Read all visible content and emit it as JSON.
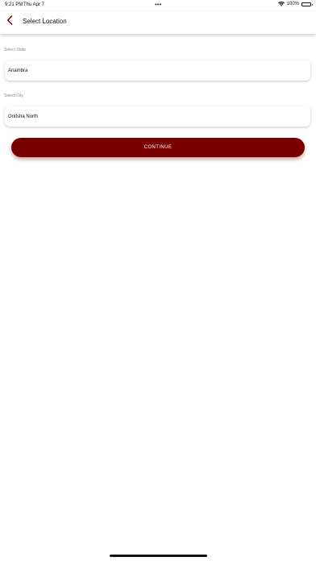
{
  "status_bar": {
    "time": "9:21 PM",
    "date": "Thu Apr 7",
    "dots": "•••",
    "battery": "100%",
    "icons": [
      "wifi-icon",
      "battery-icon"
    ]
  },
  "nav": {
    "title": "Select Location",
    "back_icon": "chevron-left-icon"
  },
  "form": {
    "state_label": "Select State",
    "state_value": "Anambra",
    "city_label": "Select City",
    "city_value": "Onitsha North",
    "continue_label": "CONTINUE"
  },
  "colors": {
    "accent": "#7a0000",
    "background": "#ffffff",
    "label": "#8a8a8a"
  }
}
